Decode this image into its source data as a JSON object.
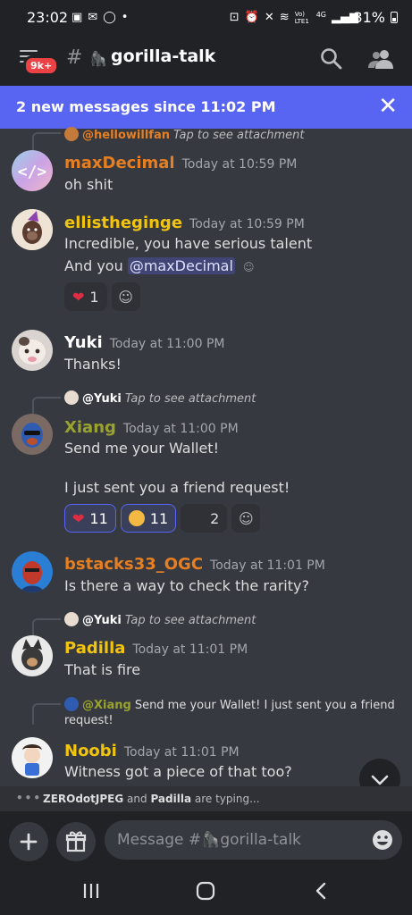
{
  "status": {
    "time": "23:02",
    "left_icons": [
      "image-icon",
      "mail-icon",
      "whatsapp-icon",
      "dot-icon"
    ],
    "right_icons": [
      "lock-icon",
      "alarm-icon",
      "mute-icon",
      "wifi-icon",
      "volte-icon",
      "signal-icon"
    ],
    "volte_label": "Vo) LTE1",
    "network": "4G",
    "battery": "31%"
  },
  "header": {
    "badge": "9k+",
    "hash": "#",
    "channel_name": "gorilla-talk",
    "channel_icon": "gorilla-icon"
  },
  "new_messages": {
    "text": "2 new messages since 11:02 PM"
  },
  "messages": [
    {
      "reply_name": "@hellowillfan",
      "reply_text": "Tap to see attachment",
      "username": "maxDecimal",
      "time": "Today at 10:59 PM",
      "lines": [
        "oh shit"
      ]
    },
    {
      "username": "ellistheginge",
      "time": "Today at 10:59 PM",
      "lines": [
        "Incredible, you have serious talent",
        "And you "
      ],
      "mention": "@maxDecimal",
      "reactions": [
        {
          "emoji": "heart",
          "count": "1"
        }
      ]
    },
    {
      "username": "Yuki",
      "time": "Today at 11:00 PM",
      "lines": [
        "Thanks!"
      ]
    },
    {
      "reply_name": "@Yuki",
      "reply_text": "Tap to see attachment",
      "username": "Xiang",
      "time": "Today at 11:00 PM",
      "lines": [
        "Send me your Wallet!",
        "I just sent you a friend request!"
      ],
      "reactions": [
        {
          "emoji": "heart",
          "count": "11"
        },
        {
          "emoji": "exploding-head",
          "count": "11"
        },
        {
          "emoji": "custom-emoji",
          "count": "2"
        }
      ]
    },
    {
      "username": "bstacks33_OGC",
      "time": "Today at 11:01 PM",
      "lines": [
        "Is there a way to check the rarity?"
      ]
    },
    {
      "reply_name": "@Yuki",
      "reply_text": "Tap to see attachment",
      "username": "Padilla",
      "time": "Today at 11:01 PM",
      "lines": [
        "That is fire"
      ]
    },
    {
      "reply_name": "@Xiang",
      "reply_text": "Send me your Wallet!   I just sent you a friend",
      "reply_text_2": "request!",
      "username": "Noobi",
      "time": "Today at 11:01 PM",
      "lines": [
        "Witness got a piece of that too?"
      ]
    }
  ],
  "typing": {
    "dots": "•••",
    "user1": "ZEROdotJPEG",
    "and": " and ",
    "user2": "Padilla",
    "suffix": " are typing..."
  },
  "composer": {
    "placeholder_prefix": "Message #",
    "placeholder_channel": "gorilla-talk"
  },
  "colors": {
    "background": "#36393f",
    "bars": "#202225",
    "blurple": "#5865f2",
    "orange_name": "#e67e22",
    "yellow_name": "#f1c40f",
    "olive_name": "#9aa32d",
    "white_name": "#ffffff",
    "red": "#ed4245"
  }
}
